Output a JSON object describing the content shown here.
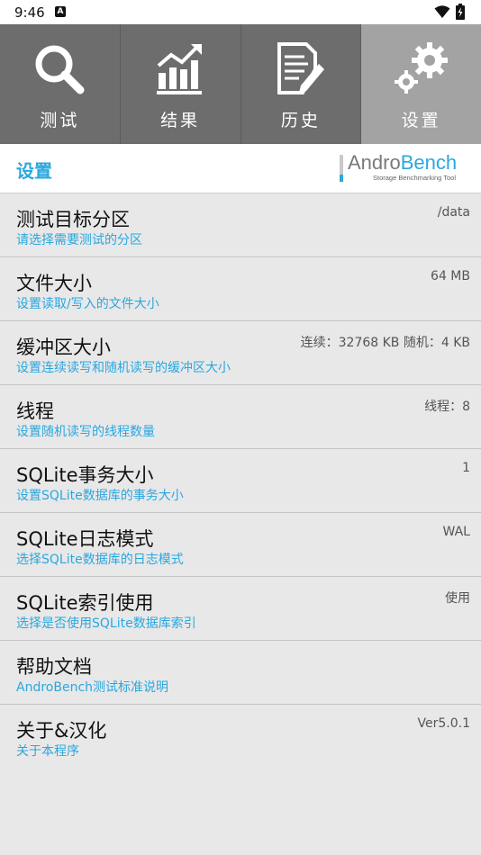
{
  "status_bar": {
    "time": "9:46",
    "notification_glyph": "A"
  },
  "tabs": [
    {
      "label": "测试",
      "icon": "search-icon",
      "active": false
    },
    {
      "label": "结果",
      "icon": "chart-icon",
      "active": false
    },
    {
      "label": "历史",
      "icon": "document-edit-icon",
      "active": false
    },
    {
      "label": "设置",
      "icon": "gear-icon",
      "active": true
    }
  ],
  "header": {
    "title": "设置",
    "logo_text_a": "Andro",
    "logo_text_b": "Bench",
    "logo_subtitle": "Storage Benchmarking Tool"
  },
  "settings": [
    {
      "title": "测试目标分区",
      "subtitle": "请选择需要测试的分区",
      "value": "/data"
    },
    {
      "title": "文件大小",
      "subtitle": "设置读取/写入的文件大小",
      "value": "64 MB"
    },
    {
      "title": "缓冲区大小",
      "subtitle": "设置连续读写和随机读写的缓冲区大小",
      "value": "连续：32768 KB  随机：4 KB"
    },
    {
      "title": "线程",
      "subtitle": "设置随机读写的线程数量",
      "value": "线程：8"
    },
    {
      "title": "SQLite事务大小",
      "subtitle": "设置SQLite数据库的事务大小",
      "value": "1"
    },
    {
      "title": "SQLite日志模式",
      "subtitle": "选择SQLite数据库的日志模式",
      "value": "WAL"
    },
    {
      "title": "SQLite索引使用",
      "subtitle": "选择是否使用SQLite数据库索引",
      "value": "使用"
    },
    {
      "title": "帮助文档",
      "subtitle": "AndroBench测试标准说明",
      "value": ""
    },
    {
      "title": "关于&汉化",
      "subtitle": "关于本程序",
      "value": "Ver5.0.1"
    }
  ],
  "colors": {
    "accent": "#2aa7df",
    "tab_bg": "#6d6d6d",
    "tab_active_bg": "#a3a3a3"
  }
}
